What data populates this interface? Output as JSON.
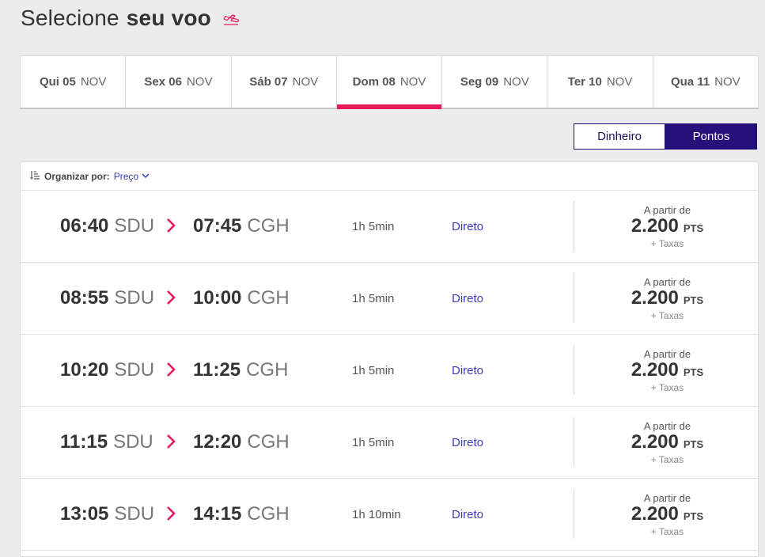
{
  "header": {
    "title_light": "Selecione",
    "title_bold": "seu voo",
    "icon": "plane-takeoff-icon"
  },
  "dates": [
    {
      "day": "Qui 05",
      "month": "NOV",
      "active": false
    },
    {
      "day": "Sex 06",
      "month": "NOV",
      "active": false
    },
    {
      "day": "Sáb 07",
      "month": "NOV",
      "active": false
    },
    {
      "day": "Dom 08",
      "month": "NOV",
      "active": true
    },
    {
      "day": "Seg 09",
      "month": "NOV",
      "active": false
    },
    {
      "day": "Ter 10",
      "month": "NOV",
      "active": false
    },
    {
      "day": "Qua 11",
      "month": "NOV",
      "active": false
    }
  ],
  "payment_toggle": {
    "cash_label": "Dinheiro",
    "points_label": "Pontos",
    "selected": "Pontos"
  },
  "sort": {
    "label": "Organizar por:",
    "value": "Preço"
  },
  "flights": [
    {
      "dep_time": "06:40",
      "dep_code": "SDU",
      "arr_time": "07:45",
      "arr_code": "CGH",
      "duration": "1h 5min",
      "stops": "Direto",
      "price_from": "A partir de",
      "price": "2.200",
      "unit": "PTS",
      "taxes": "+ Taxas"
    },
    {
      "dep_time": "08:55",
      "dep_code": "SDU",
      "arr_time": "10:00",
      "arr_code": "CGH",
      "duration": "1h 5min",
      "stops": "Direto",
      "price_from": "A partir de",
      "price": "2.200",
      "unit": "PTS",
      "taxes": "+ Taxas"
    },
    {
      "dep_time": "10:20",
      "dep_code": "SDU",
      "arr_time": "11:25",
      "arr_code": "CGH",
      "duration": "1h 5min",
      "stops": "Direto",
      "price_from": "A partir de",
      "price": "2.200",
      "unit": "PTS",
      "taxes": "+ Taxas"
    },
    {
      "dep_time": "11:15",
      "dep_code": "SDU",
      "arr_time": "12:20",
      "arr_code": "CGH",
      "duration": "1h 5min",
      "stops": "Direto",
      "price_from": "A partir de",
      "price": "2.200",
      "unit": "PTS",
      "taxes": "+ Taxas"
    },
    {
      "dep_time": "13:05",
      "dep_code": "SDU",
      "arr_time": "14:15",
      "arr_code": "CGH",
      "duration": "1h 10min",
      "stops": "Direto",
      "price_from": "A partir de",
      "price": "2.200",
      "unit": "PTS",
      "taxes": "+ Taxas"
    }
  ],
  "colors": {
    "accent": "#e8195a",
    "brand": "#26117a",
    "link": "#3b3bbf"
  }
}
